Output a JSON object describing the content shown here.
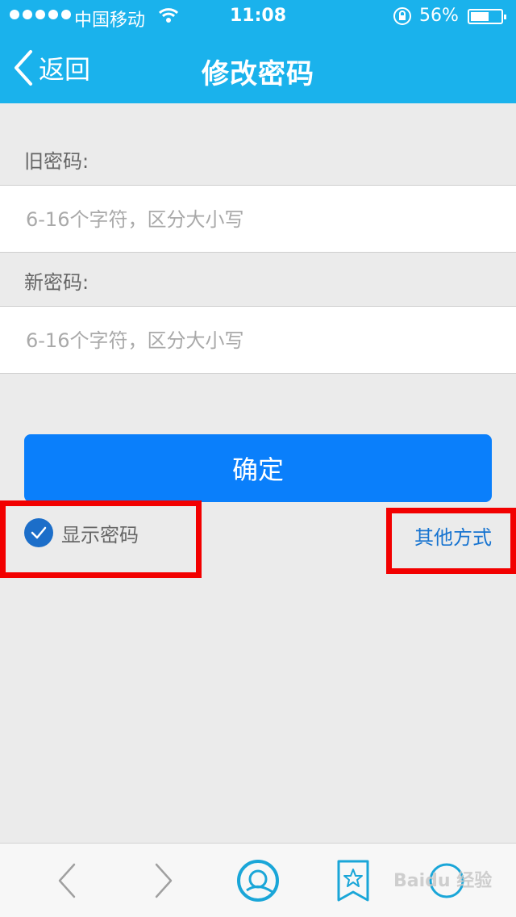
{
  "status_bar": {
    "carrier": "中国移动",
    "time": "11:08",
    "battery_percent": "56%"
  },
  "nav": {
    "back_label": "返回",
    "title": "修改密码"
  },
  "form": {
    "old_password_label": "旧密码:",
    "old_password_placeholder": "6-16个字符，区分大小写",
    "new_password_label": "新密码:",
    "new_password_placeholder": "6-16个字符，区分大小写",
    "confirm_label": "确定"
  },
  "options": {
    "show_password_label": "显示密码",
    "show_password_checked": true,
    "other_method_label": "其他方式"
  },
  "watermark": "Baidu 经验",
  "colors": {
    "header_bg": "#1ab2ec",
    "confirm_bg": "#0a7ffb",
    "link": "#1673d0",
    "highlight": "#f20000"
  }
}
